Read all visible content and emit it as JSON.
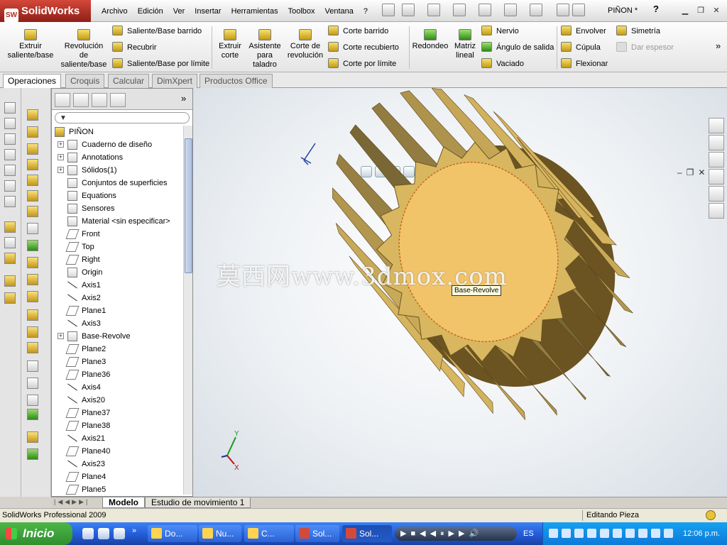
{
  "app": {
    "logo": "SolidWorks",
    "logo_badge": "SW",
    "document_title": "PIÑON *",
    "help": "?"
  },
  "menu": [
    "Archivo",
    "Edición",
    "Ver",
    "Insertar",
    "Herramientas",
    "Toolbox",
    "Ventana",
    "?"
  ],
  "commands": {
    "extrude_boss": [
      "Extruir",
      "saliente/base"
    ],
    "revolve_boss": [
      "Revolución",
      "de",
      "saliente/base"
    ],
    "swept_boss": "Saliente/Base barrido",
    "loft_boss": "Recubrir",
    "boundary_boss": "Saliente/Base por límite",
    "extrude_cut": [
      "Extruir",
      "corte"
    ],
    "hole_wizard": [
      "Asistente",
      "para",
      "taladro"
    ],
    "revolve_cut": [
      "Corte de",
      "revolución"
    ],
    "swept_cut": "Corte barrido",
    "loft_cut": "Corte recubierto",
    "boundary_cut": "Corte por límite",
    "fillet": "Redondeo",
    "linear_pattern": [
      "Matriz",
      "lineal"
    ],
    "rib": "Nervio",
    "draft": "Ángulo de salida",
    "shell": "Vaciado",
    "wrap": "Envolver",
    "dome": "Cúpula",
    "flex": "Flexionar",
    "mirror": "Simetría",
    "thicken": "Dar espesor"
  },
  "tabs": [
    "Operaciones",
    "Croquis",
    "Calcular",
    "DimXpert",
    "Productos Office"
  ],
  "tree": {
    "root": "PIÑON",
    "items": [
      {
        "label": "Cuaderno de diseño",
        "expand": "+"
      },
      {
        "label": "Annotations",
        "expand": "+"
      },
      {
        "label": "Sólidos(1)",
        "expand": "+"
      },
      {
        "label": "Conjuntos de superficies",
        "expand": ""
      },
      {
        "label": "Equations",
        "expand": ""
      },
      {
        "label": "Sensores",
        "expand": ""
      },
      {
        "label": "Material <sin especificar>",
        "expand": ""
      },
      {
        "label": "Front",
        "expand": ""
      },
      {
        "label": "Top",
        "expand": ""
      },
      {
        "label": "Right",
        "expand": ""
      },
      {
        "label": "Origin",
        "expand": ""
      },
      {
        "label": "Axis1",
        "expand": ""
      },
      {
        "label": "Axis2",
        "expand": ""
      },
      {
        "label": "Plane1",
        "expand": ""
      },
      {
        "label": "Axis3",
        "expand": ""
      },
      {
        "label": "Base-Revolve",
        "expand": "+"
      },
      {
        "label": "Plane2",
        "expand": ""
      },
      {
        "label": "Plane3",
        "expand": ""
      },
      {
        "label": "Plane36",
        "expand": ""
      },
      {
        "label": "Axis4",
        "expand": ""
      },
      {
        "label": "Axis20",
        "expand": ""
      },
      {
        "label": "Plane37",
        "expand": ""
      },
      {
        "label": "Plane38",
        "expand": ""
      },
      {
        "label": "Axis21",
        "expand": ""
      },
      {
        "label": "Plane40",
        "expand": ""
      },
      {
        "label": "Axis23",
        "expand": ""
      },
      {
        "label": "Plane4",
        "expand": ""
      },
      {
        "label": "Plane5",
        "expand": ""
      }
    ]
  },
  "viewport": {
    "watermark": "莫西网www.3dmox.com",
    "tooltip": "Base-Revolve",
    "triad": {
      "y": "Y",
      "x": "X"
    }
  },
  "model_tabs": [
    "Modelo",
    "Estudio de movimiento 1"
  ],
  "status": {
    "left": "SolidWorks Professional 2009",
    "right": "Editando Pieza"
  },
  "taskbar": {
    "start": "Inicio",
    "tasks": [
      "Do...",
      "Nu...",
      "C...",
      "Sol...",
      "Sol..."
    ],
    "language": "ES",
    "clock": "12:06 p.m."
  },
  "colors": {
    "gear": "#d9b760",
    "gear_face": "#f2c46a",
    "gear_shadow": "#6b5422",
    "sw_red": "#b52a1e"
  }
}
